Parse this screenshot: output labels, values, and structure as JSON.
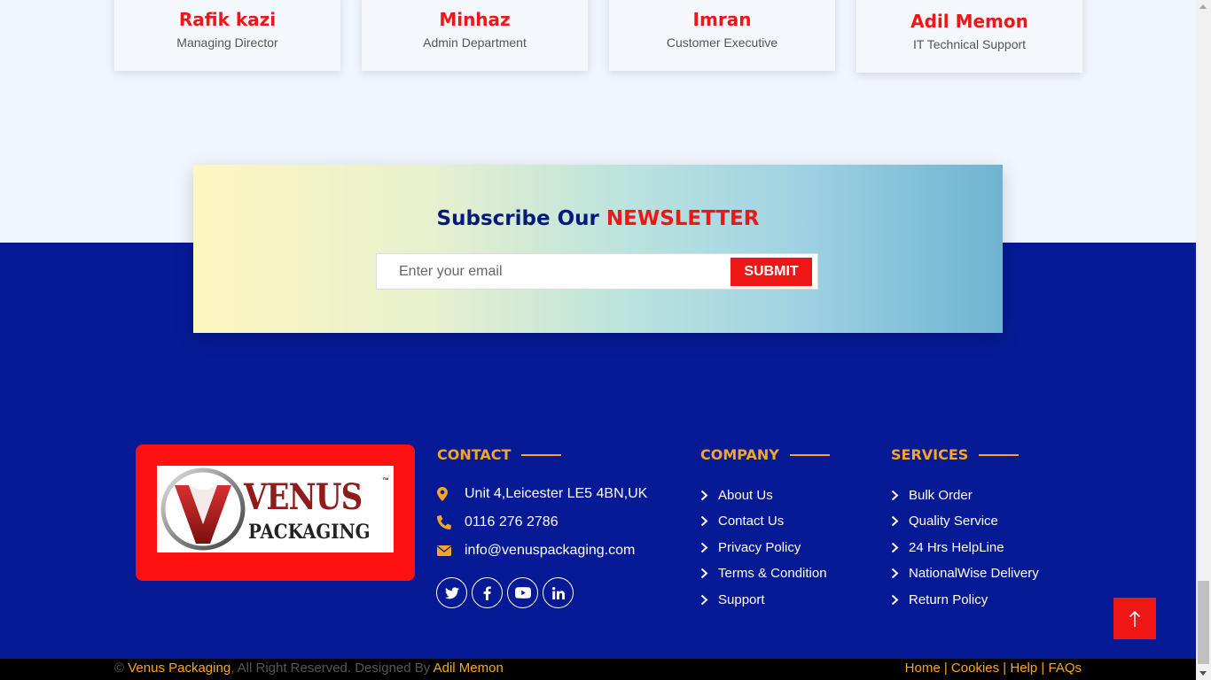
{
  "team": [
    {
      "name": "Rafik kazi",
      "role": "Managing Director"
    },
    {
      "name": "Minhaz",
      "role": "Admin Department"
    },
    {
      "name": "Imran",
      "role": "Customer Executive"
    },
    {
      "name": "Adil Memon",
      "role": "IT Technical Support"
    }
  ],
  "newsletter": {
    "title_main": "Subscribe Our",
    "title_accent": "NEWSLETTER",
    "email_placeholder": "Enter your email",
    "email_value": "",
    "submit_label": "SUBMIT"
  },
  "logo": {
    "word": "VENUS",
    "tm": "™",
    "sub": "PACKAGING"
  },
  "contact": {
    "heading": "CONTACT",
    "address": "Unit 4,Leicester LE5 4BN,UK",
    "phone": "0116 276 2786",
    "email": "info@venuspackaging.com",
    "social_icons": [
      "twitter-icon",
      "facebook-icon",
      "youtube-icon",
      "linkedin-icon"
    ]
  },
  "company": {
    "heading": "COMPANY",
    "links": [
      "About Us",
      "Contact Us",
      "Privacy Policy",
      "Terms & Condition",
      "Support"
    ]
  },
  "services": {
    "heading": "SERVICES",
    "links": [
      "Bulk Order",
      "Quality Service",
      "24 Hrs HelpLine",
      "NationalWise Delivery",
      "Return Policy"
    ]
  },
  "bottom": {
    "copyright_symbol": "©",
    "brand": "Venus Packaging",
    "rights": ", All Right Reserved. Designed By",
    "designer": "Adil Memon",
    "links": [
      "Home",
      "Cookies",
      "Help",
      "FAQs"
    ],
    "separator": "|"
  },
  "colors": {
    "brand_red": "#ef1616",
    "footer_navy": "#061a96",
    "accent_orange": "#f6a623",
    "title_navy": "#061a7e"
  }
}
